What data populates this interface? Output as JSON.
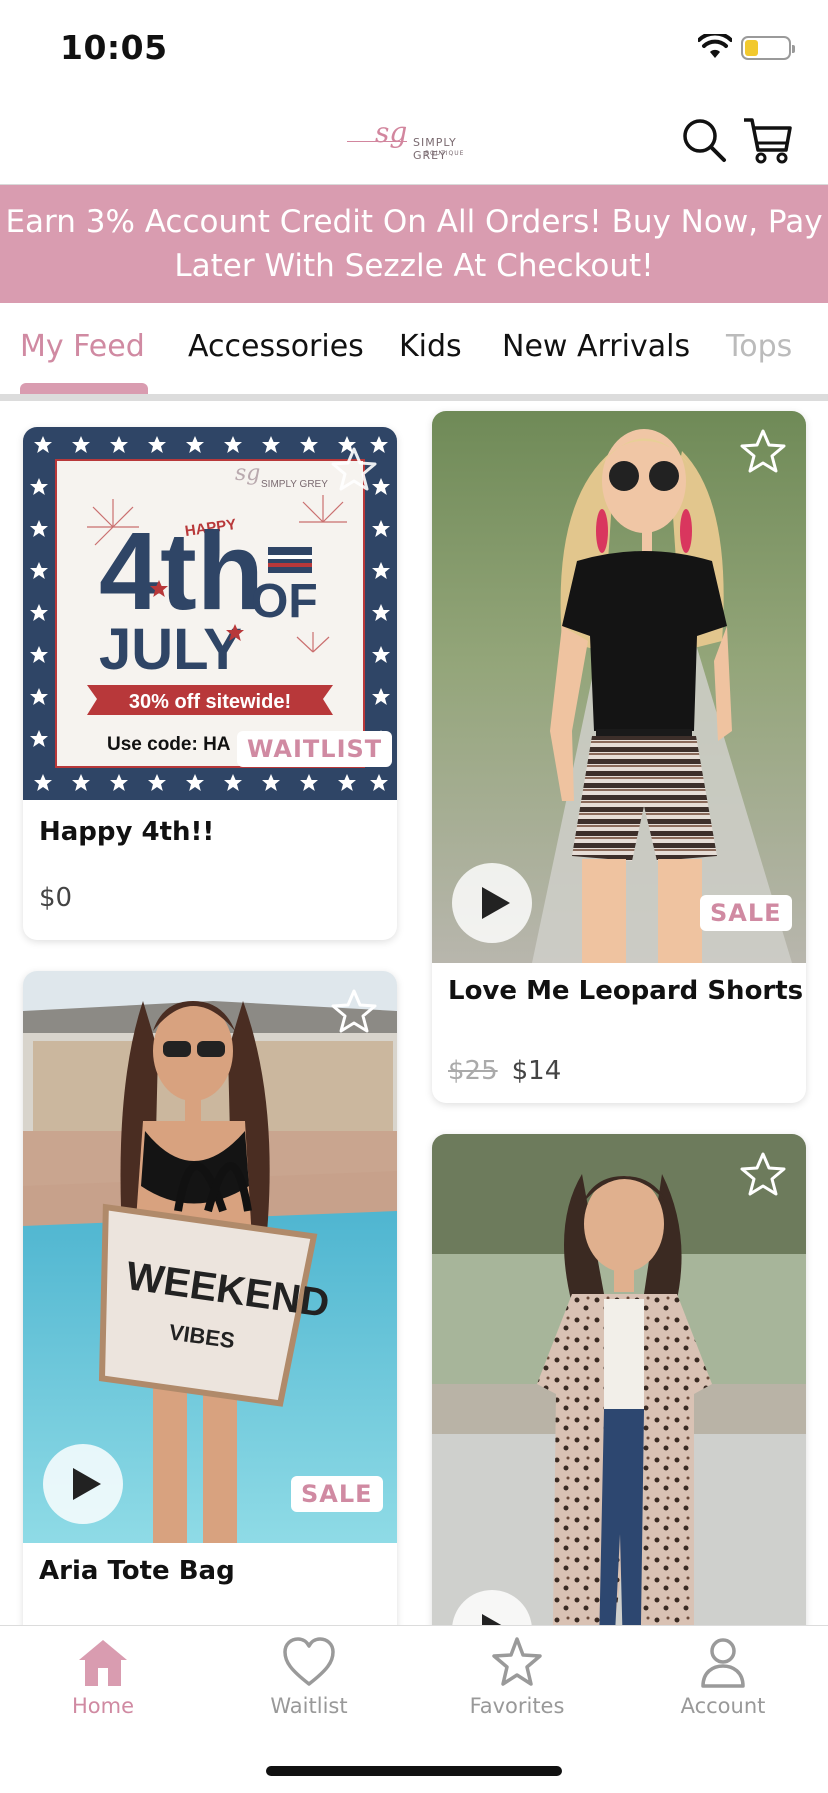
{
  "status_bar": {
    "time": "10:05",
    "battery_fraction": 0.3
  },
  "header": {
    "logo": {
      "monogram": "sg",
      "name": "SIMPLY GREY",
      "sub": "BOUTIQUE"
    },
    "search_icon": "search-icon",
    "cart_icon": "cart-icon"
  },
  "promo": {
    "line1": "Earn 3% Account Credit On All Orders! Buy Now, Pay",
    "line2": "Later With Sezzle At Checkout!",
    "background": "#d99cb0"
  },
  "tabs": [
    {
      "label": "My Feed",
      "active": true
    },
    {
      "label": "Accessories"
    },
    {
      "label": "Kids"
    },
    {
      "label": "New Arrivals"
    },
    {
      "label": "Tops"
    }
  ],
  "feed": {
    "cards": [
      {
        "title": "Happy 4th!!",
        "price": "$0",
        "badge": "WAITLIST",
        "image": {
          "logo_monogram": "sg",
          "logo_name": "SIMPLY GREY",
          "happy": "HAPPY",
          "big": "4th",
          "of": "OF",
          "month": "JULY",
          "offer": "30% off sitewide!",
          "code": "Use code: HA"
        }
      },
      {
        "title": "Love Me Leopard Shorts",
        "old_price": "$25",
        "price": "$14",
        "badge": "SALE",
        "video": true
      },
      {
        "title": "Aria Tote Bag",
        "badge": "SALE",
        "video": true,
        "image": {
          "bag_line1": "WEEKEND",
          "bag_line2": "VIBES"
        }
      },
      {
        "title": "",
        "video": true
      }
    ]
  },
  "bottom_nav": [
    {
      "label": "Home",
      "icon": "home-icon",
      "active": true
    },
    {
      "label": "Waitlist",
      "icon": "heart-icon"
    },
    {
      "label": "Favorites",
      "icon": "star-icon"
    },
    {
      "label": "Account",
      "icon": "person-icon"
    }
  ],
  "colors": {
    "accent": "#d08aa2",
    "banner_pink": "#d99cb0",
    "july_navy": "#2f4566",
    "july_red": "#b8383a"
  }
}
